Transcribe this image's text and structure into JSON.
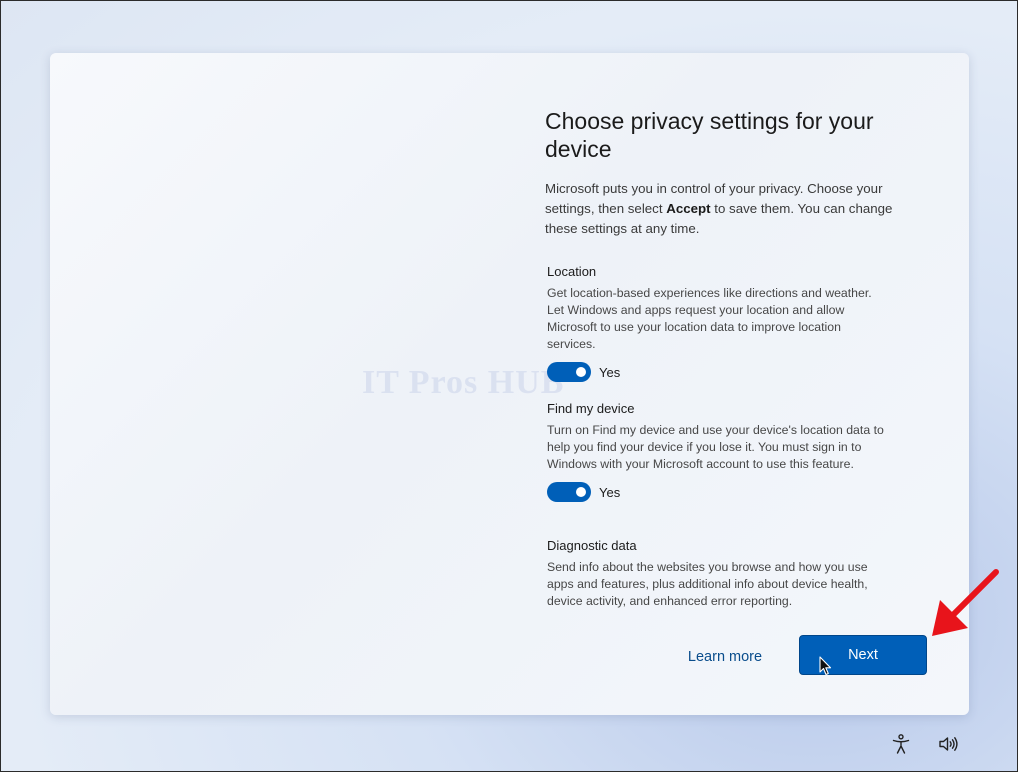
{
  "watermark": "IT Pros HUB",
  "page": {
    "title": "Choose privacy settings for your device",
    "intro_before": "Microsoft puts you in control of your privacy. Choose your settings, then select ",
    "intro_bold": "Accept",
    "intro_after": " to save them. You can change these settings at any time."
  },
  "settings": [
    {
      "title": "Location",
      "description": "Get location-based experiences like directions and weather. Let Windows and apps request your location and allow Microsoft to use your location data to improve location services.",
      "toggle_label": "Yes",
      "enabled": true
    },
    {
      "title": "Find my device",
      "description": "Turn on Find my device and use your device's location data to help you find your device if you lose it. You must sign in to Windows with your Microsoft account to use this feature.",
      "toggle_label": "Yes",
      "enabled": true
    },
    {
      "title": "Diagnostic data",
      "description": "Send info about the websites you browse and how you use apps and features, plus additional info about device health, device activity, and enhanced error reporting."
    }
  ],
  "footer": {
    "learn_more_label": "Learn more",
    "next_label": "Next"
  },
  "taskbar": {
    "icons": [
      "accessibility-icon",
      "volume-icon"
    ]
  },
  "colors": {
    "accent": "#005fb8",
    "annotation_arrow": "#e8141b"
  }
}
